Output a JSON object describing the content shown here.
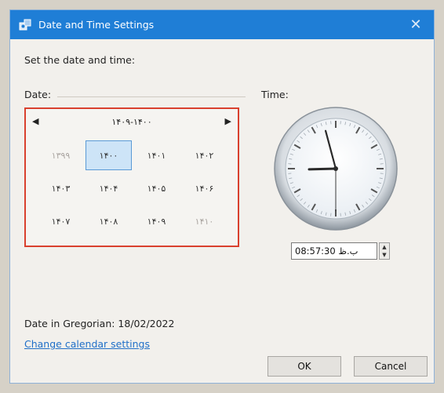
{
  "window": {
    "title": "Date and Time Settings",
    "close_glyph": "✕"
  },
  "heading": "Set the date and time:",
  "date_section": {
    "label": "Date:",
    "nav_prev": "◀",
    "nav_next": "▶",
    "range": "۱۴۰۹-۱۴۰۰",
    "years": [
      {
        "label": "۱۳۹۹",
        "state": "dim"
      },
      {
        "label": "۱۴۰۰",
        "state": "selected"
      },
      {
        "label": "۱۴۰۱",
        "state": ""
      },
      {
        "label": "۱۴۰۲",
        "state": ""
      },
      {
        "label": "۱۴۰۳",
        "state": ""
      },
      {
        "label": "۱۴۰۴",
        "state": ""
      },
      {
        "label": "۱۴۰۵",
        "state": ""
      },
      {
        "label": "۱۴۰۶",
        "state": ""
      },
      {
        "label": "۱۴۰۷",
        "state": ""
      },
      {
        "label": "۱۴۰۸",
        "state": ""
      },
      {
        "label": "۱۴۰۹",
        "state": ""
      },
      {
        "label": "۱۴۱۰",
        "state": "dim"
      }
    ]
  },
  "time_section": {
    "label": "Time:",
    "clock": {
      "hour": 8,
      "minute": 57,
      "second": 30
    },
    "time_value": "08:57:30 ب.ظ",
    "spin_up": "▲",
    "spin_down": "▼"
  },
  "gregorian": "Date in Gregorian: 18/02/2022",
  "change_link": "Change calendar settings",
  "buttons": {
    "ok": "OK",
    "cancel": "Cancel"
  },
  "colors": {
    "titlebar": "#1f7ed6",
    "highlight_border": "#d9402e",
    "selected_year": "#cde4f7",
    "link": "#1f6fc8"
  }
}
